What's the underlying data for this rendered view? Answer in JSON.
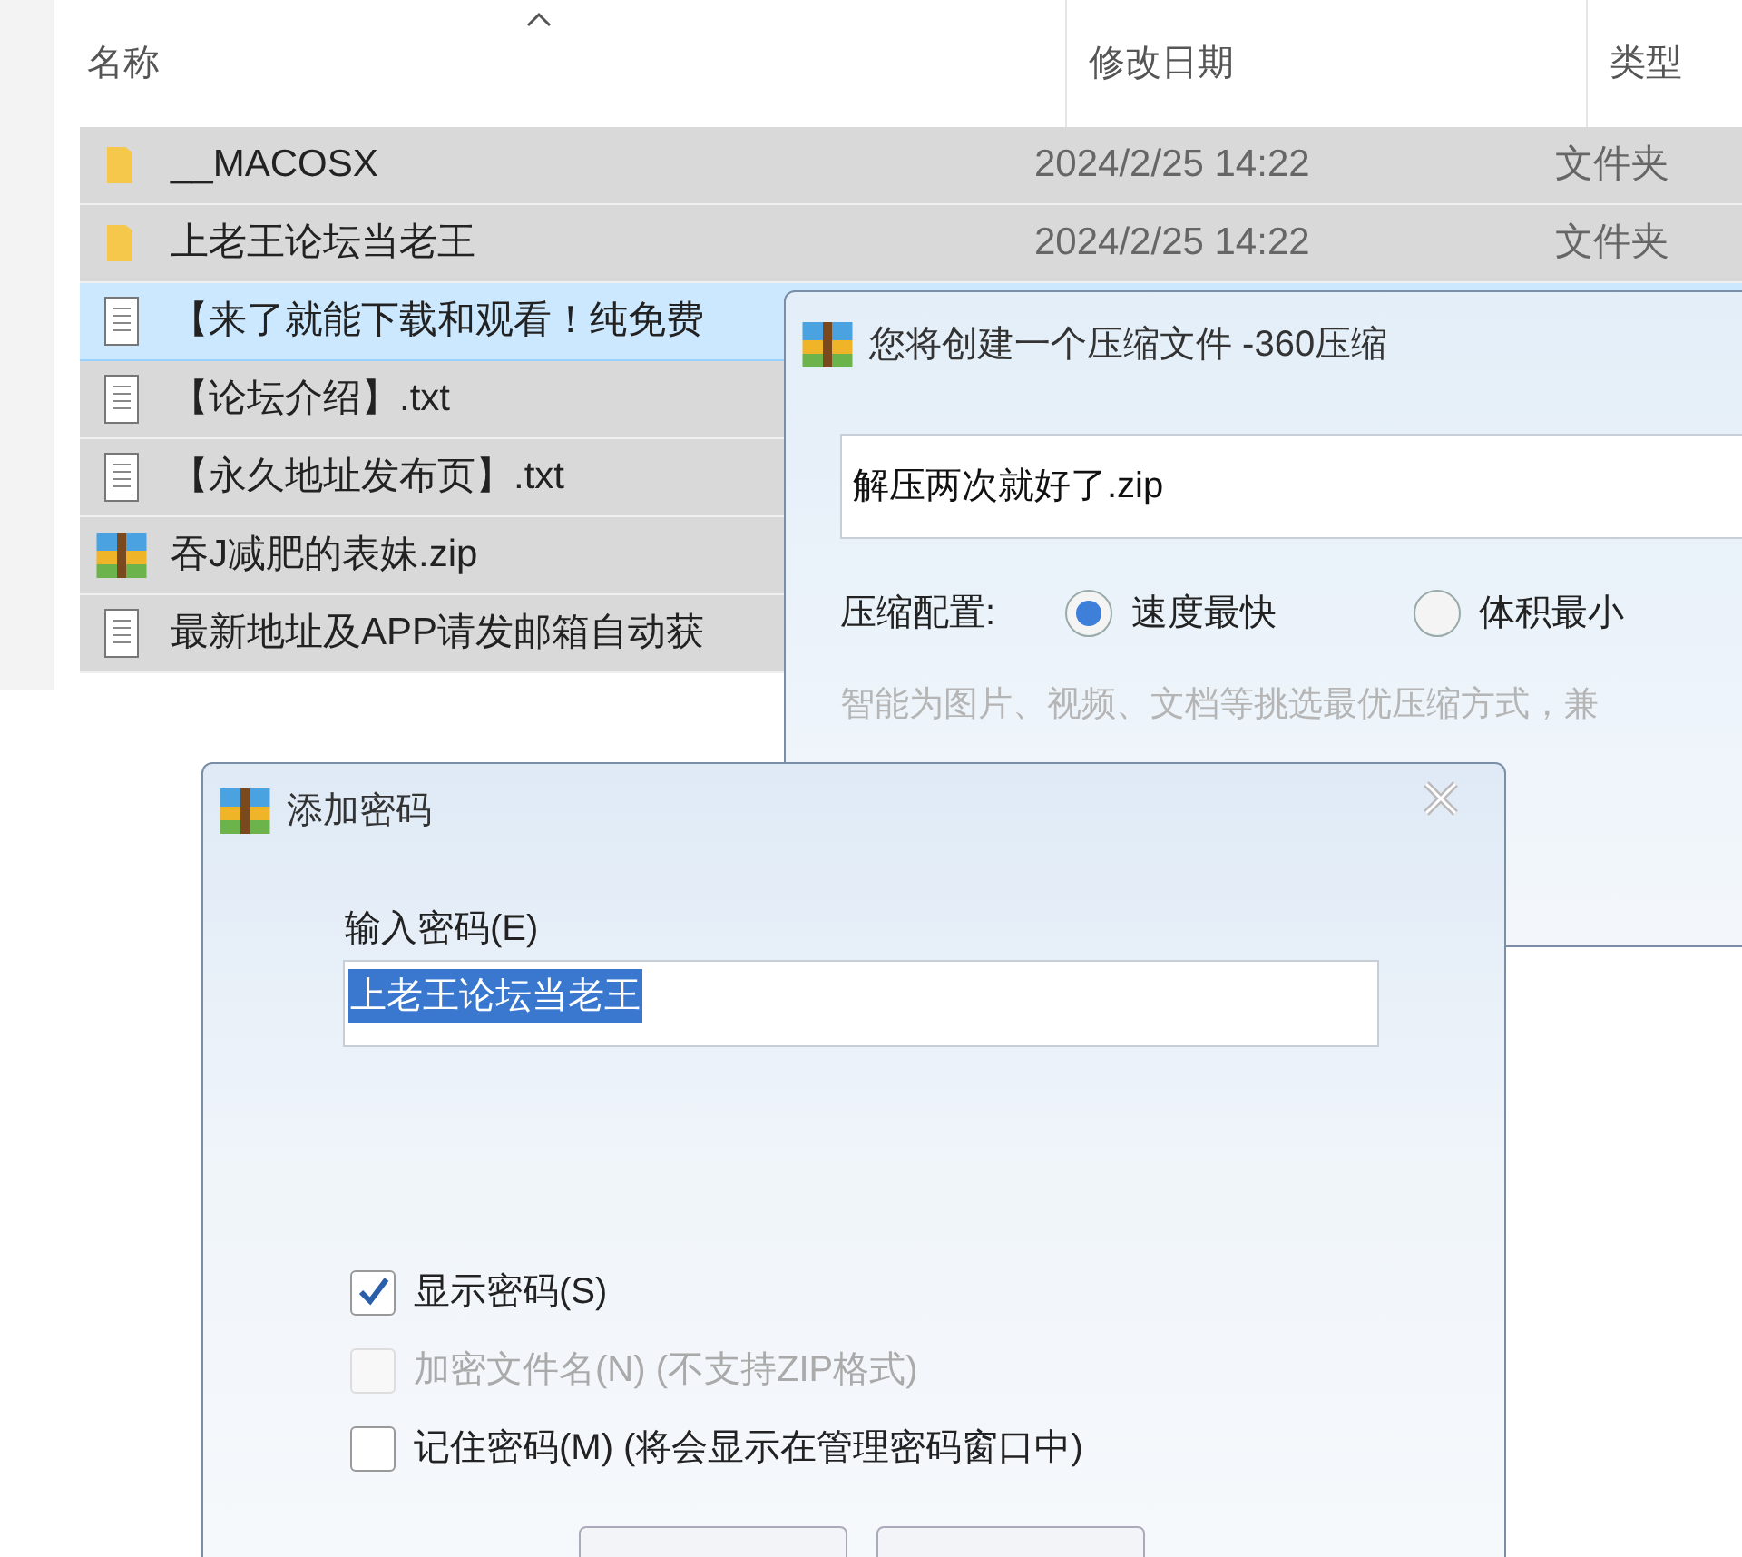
{
  "explorer": {
    "columns": [
      {
        "label": "名称",
        "sorted": true
      },
      {
        "label": "修改日期",
        "sorted": false
      },
      {
        "label": "类型",
        "sorted": false
      }
    ],
    "rows": [
      {
        "kind": "folder",
        "name": "__MACOSX",
        "date": "2024/2/25 14:22",
        "type": "文件夹",
        "selected": true,
        "hovered": false
      },
      {
        "kind": "folder",
        "name": "上老王论坛当老王",
        "date": "2024/2/25 14:22",
        "type": "文件夹",
        "selected": true,
        "hovered": false
      },
      {
        "kind": "text",
        "name": "【来了就能下载和观看！纯免费",
        "selected": true,
        "hovered": true
      },
      {
        "kind": "text",
        "name": "【论坛介绍】.txt",
        "selected": true,
        "hovered": false
      },
      {
        "kind": "text",
        "name": "【永久地址发布页】.txt",
        "selected": true,
        "hovered": false
      },
      {
        "kind": "archive",
        "name": "吞J减肥的表妹.zip",
        "selected": true,
        "hovered": false
      },
      {
        "kind": "text",
        "name": "最新地址及APP请发邮箱自动获",
        "selected": true,
        "hovered": false
      }
    ]
  },
  "compress_dialog": {
    "title": "您将创建一个压缩文件 -360压缩",
    "filename": "解压两次就好了.zip",
    "config_label": "压缩配置:",
    "options": [
      {
        "label": "速度最快",
        "selected": true
      },
      {
        "label": "体积最小",
        "selected": false
      }
    ],
    "hint": "智能为图片、视频、文档等挑选最优压缩方式，兼"
  },
  "password_dialog": {
    "title": "添加密码",
    "field_label": "输入密码(E)",
    "password": "上老王论坛当老王",
    "checkboxes": [
      {
        "label": "显示密码(S)",
        "checked": true,
        "disabled": false
      },
      {
        "label": "加密文件名(N) (不支持ZIP格式)",
        "checked": false,
        "disabled": true
      },
      {
        "label": "记住密码(M) (将会显示在管理密码窗口中)",
        "checked": false,
        "disabled": false
      }
    ]
  }
}
